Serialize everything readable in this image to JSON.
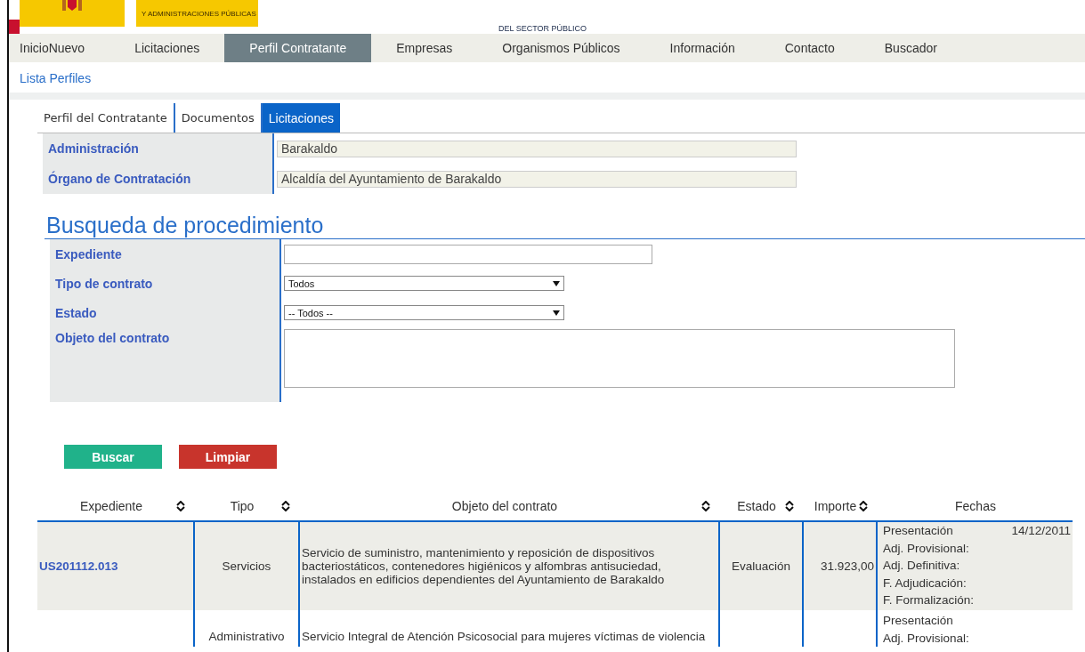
{
  "header": {
    "ministry_line": "Y ADMINISTRACIONES PÚBLICAS",
    "logo_subtitle": "DEL SECTOR PÚBLICO"
  },
  "nav": [
    {
      "label": "InicioNuevo",
      "selected": false
    },
    {
      "label": "Licitaciones",
      "selected": false
    },
    {
      "label": "Perfil Contratante",
      "selected": true
    },
    {
      "label": "Empresas",
      "selected": false
    },
    {
      "label": "Organismos Públicos",
      "selected": false
    },
    {
      "label": "Información",
      "selected": false
    },
    {
      "label": "Contacto",
      "selected": false
    },
    {
      "label": "Buscador",
      "selected": false
    }
  ],
  "breadcrumb": "Lista Perfiles",
  "tabs": [
    {
      "label": "Perfil del Contratante",
      "selected": false
    },
    {
      "label": "Documentos",
      "selected": false
    },
    {
      "label": "Licitaciones",
      "selected": true
    }
  ],
  "info": [
    {
      "label": "Administración",
      "value": "Barakaldo"
    },
    {
      "label": "Órgano de Contratación",
      "value": "Alcaldía del Ayuntamiento de Barakaldo"
    }
  ],
  "search_title": "Busqueda de procedimiento",
  "form": [
    {
      "kind": "text",
      "label": "Expediente"
    },
    {
      "kind": "select",
      "label": "Tipo de contrato",
      "value": "Todos"
    },
    {
      "kind": "select",
      "label": "Estado",
      "value": "-- Todos --"
    },
    {
      "kind": "textarea",
      "label": "Objeto del contrato"
    }
  ],
  "buttons": [
    {
      "kind": "search",
      "label": "Buscar"
    },
    {
      "kind": "clear",
      "label": "Limpiar"
    }
  ],
  "table": {
    "columns": [
      {
        "label": "Expediente",
        "sortable": true
      },
      {
        "label": "Tipo",
        "sortable": true
      },
      {
        "label": "Objeto del contrato",
        "sortable": true
      },
      {
        "label": "Estado",
        "sortable": true
      },
      {
        "label": "Importe",
        "sortable": true
      },
      {
        "label": "Fechas",
        "sortable": false
      }
    ],
    "rows": [
      {
        "expediente": "US201112.013",
        "tipo": "Servicios",
        "objeto": "Servicio de suministro, mantenimiento y reposición de dispositivos bacteriostáticos, contenedores higiénicos y alfombras antisuciedad, instalados en edificios dependientes del Ayuntamiento de Barakaldo",
        "estado": "Evaluación",
        "importe": "31.923,00",
        "fechas": [
          {
            "label": "Presentación",
            "value": "14/12/2011"
          },
          {
            "label": "Adj. Provisional:"
          },
          {
            "label": "Adj. Definitiva:"
          },
          {
            "label": "F. Adjudicación:"
          },
          {
            "label": "F. Formalización:"
          }
        ]
      },
      {
        "tipo": "Administrativo",
        "objeto": "Servicio Integral de Atención Psicosocial para mujeres víctimas de violencia",
        "fechas": [
          {
            "label": "Presentación"
          },
          {
            "label": "Adj. Provisional:"
          }
        ]
      }
    ]
  }
}
